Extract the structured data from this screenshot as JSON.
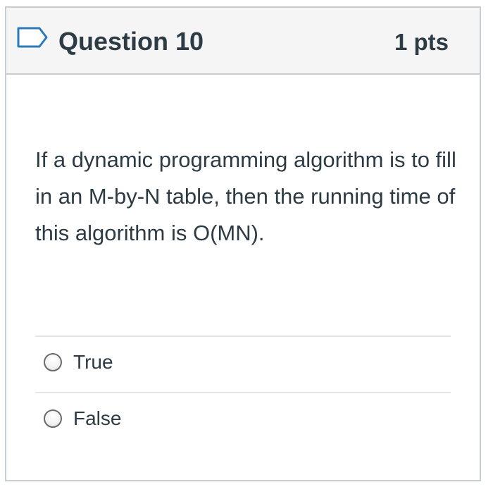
{
  "question": {
    "title": "Question 10",
    "points": "1 pts",
    "text": "If a dynamic programming algorithm is to fill in an M-by-N table, then the running time of this algorithm is O(MN).",
    "flag_icon": "flag-outline-icon",
    "accent_color": "#2d7bb6"
  },
  "answers": [
    {
      "label": "True",
      "selected": false
    },
    {
      "label": "False",
      "selected": false
    }
  ]
}
